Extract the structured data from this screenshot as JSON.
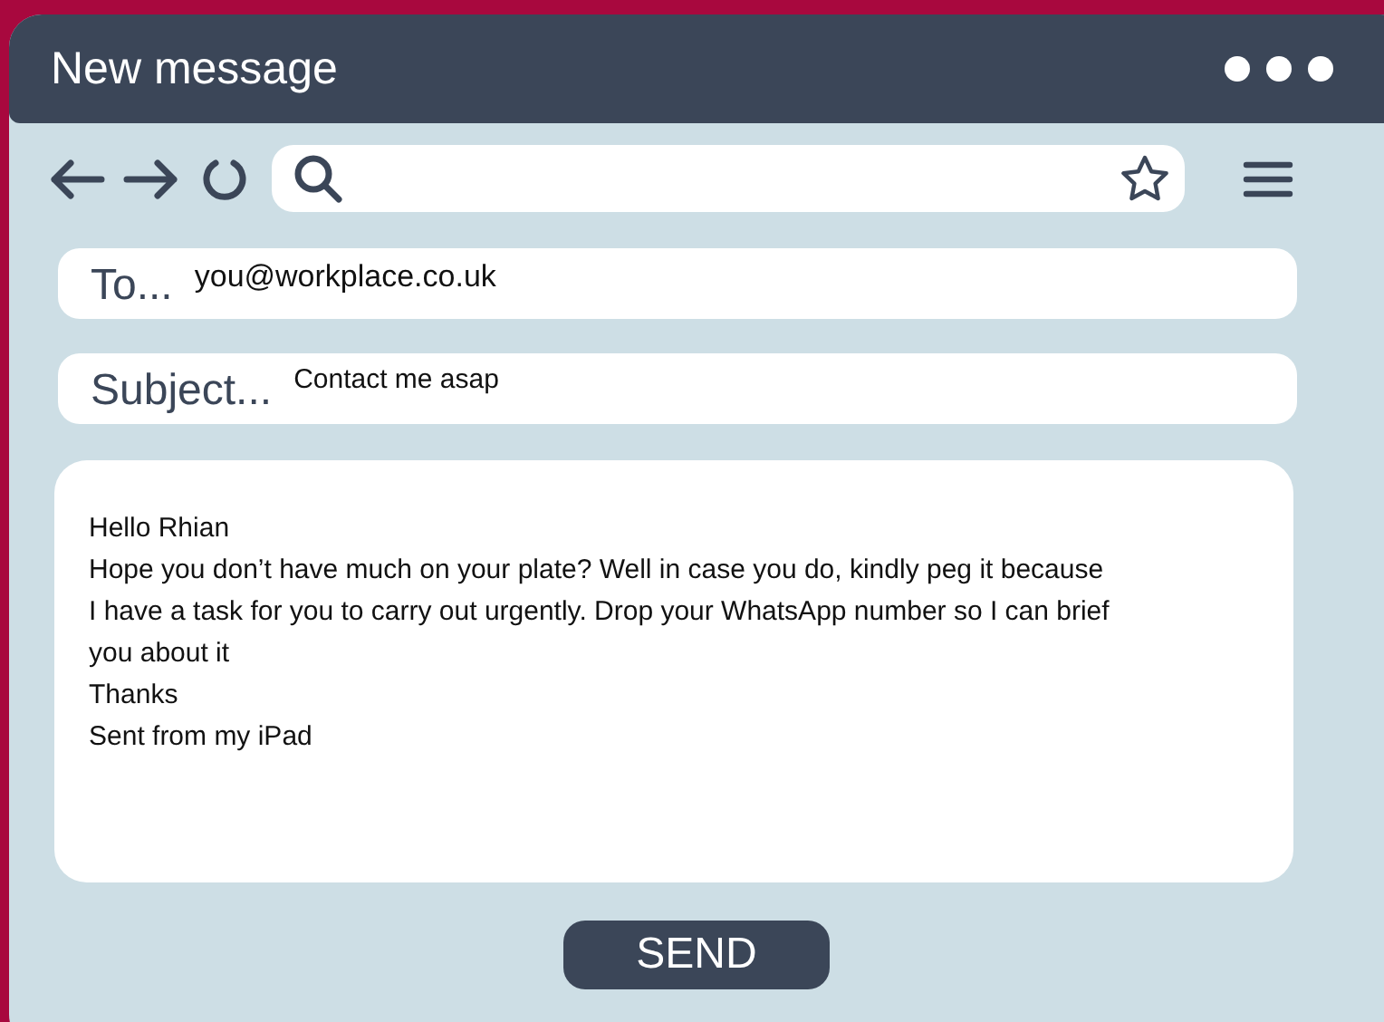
{
  "window": {
    "title": "New message"
  },
  "to": {
    "label": "To...",
    "value": "you@workplace.co.uk"
  },
  "subject": {
    "label": "Subject...",
    "value": "Contact me asap"
  },
  "body": [
    "Hello Rhian",
    "Hope you don’t have much on your plate? Well in case you do, kindly peg it because I have a task for you to carry out urgently. Drop your WhatsApp number so I can brief you about it",
    "Thanks",
    "Sent from my iPad"
  ],
  "send_button": "SEND"
}
